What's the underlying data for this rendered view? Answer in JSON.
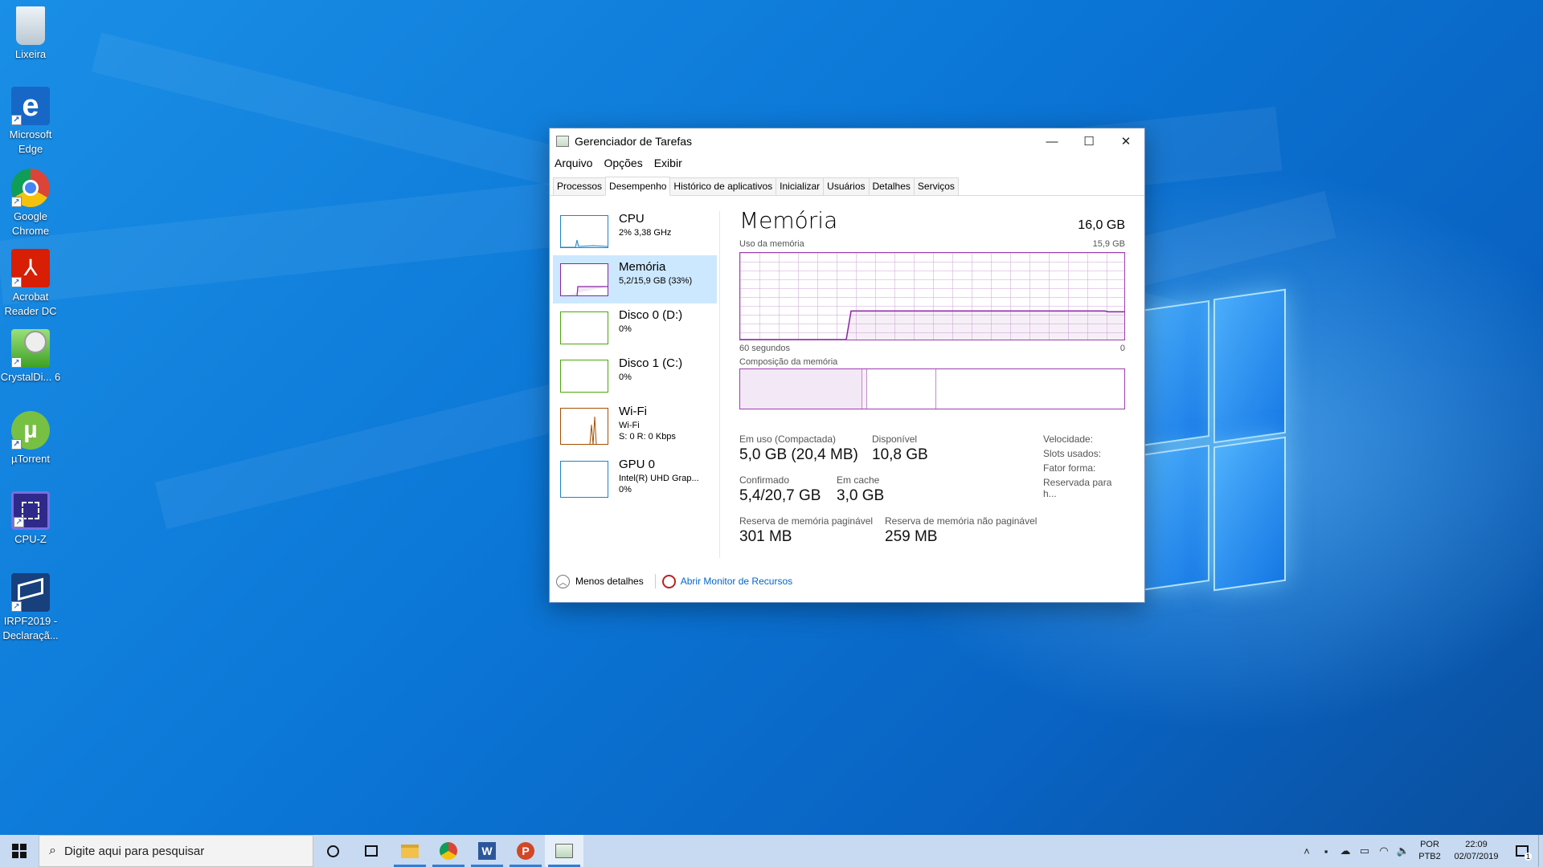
{
  "desktop": {
    "icons": [
      {
        "label": "Lixeira",
        "icon": "recycle-bin-icon"
      },
      {
        "label": "Microsoft Edge",
        "icon": "edge-icon"
      },
      {
        "label": "Google Chrome",
        "icon": "chrome-icon"
      },
      {
        "label": "Acrobat Reader DC",
        "icon": "acrobat-icon"
      },
      {
        "label": "CrystalDi... 6",
        "icon": "crystaldisk-icon"
      },
      {
        "label": "µTorrent",
        "icon": "utorrent-icon"
      },
      {
        "label": "CPU-Z",
        "icon": "cpuz-icon"
      },
      {
        "label": "IRPF2019 - Declaraçã...",
        "icon": "irpf-icon"
      }
    ]
  },
  "window": {
    "title": "Gerenciador de Tarefas",
    "controls": {
      "minimize": "—",
      "maximize": "☐",
      "close": "✕"
    },
    "menu": [
      "Arquivo",
      "Opções",
      "Exibir"
    ],
    "tabs": [
      "Processos",
      "Desempenho",
      "Histórico de aplicativos",
      "Inicializar",
      "Usuários",
      "Detalhes",
      "Serviços"
    ],
    "active_tab": "Desempenho",
    "side": [
      {
        "title": "CPU",
        "lines": [
          "2% 3,38 GHz"
        ],
        "color": "#1b86c9"
      },
      {
        "title": "Memória",
        "lines": [
          "5,2/15,9 GB (33%)"
        ],
        "color": "#8b24a3"
      },
      {
        "title": "Disco 0 (D:)",
        "lines": [
          "0%"
        ],
        "color": "#4da60c"
      },
      {
        "title": "Disco 1 (C:)",
        "lines": [
          "0%"
        ],
        "color": "#4da60c"
      },
      {
        "title": "Wi-Fi",
        "lines": [
          "Wi-Fi",
          "S: 0 R: 0 Kbps"
        ],
        "color": "#a74f01"
      },
      {
        "title": "GPU 0",
        "lines": [
          "Intel(R) UHD Grap...",
          "0%"
        ],
        "color": "#1b86c9"
      }
    ],
    "main": {
      "title": "Memória",
      "total": "16,0 GB",
      "usage_label": "Uso da memória",
      "usage_max": "15,9 GB",
      "axis_left": "60 segundos",
      "axis_right": "0",
      "composition_label": "Composição da memória",
      "usage_fraction": 0.33,
      "stats": {
        "in_use_label": "Em uso (Compactada)",
        "in_use_value": "5,0 GB (20,4 MB)",
        "available_label": "Disponível",
        "available_value": "10,8 GB",
        "committed_label": "Confirmado",
        "committed_value": "5,4/20,7 GB",
        "cached_label": "Em cache",
        "cached_value": "3,0 GB",
        "paged_label": "Reserva de memória paginável",
        "paged_value": "301 MB",
        "nonpaged_label": "Reserva de memória não paginável",
        "nonpaged_value": "259 MB"
      },
      "right_labels": [
        "Velocidade:",
        "Slots usados:",
        "Fator forma:",
        "Reservada para h..."
      ]
    },
    "footer": {
      "less_details": "Menos detalhes",
      "resource_monitor": "Abrir Monitor de Recursos"
    }
  },
  "taskbar": {
    "search_placeholder": "Digite aqui para pesquisar",
    "apps": [
      "cortana-icon",
      "task-view-icon",
      "file-explorer-icon",
      "chrome-icon",
      "word-icon",
      "powerpoint-icon",
      "task-manager-icon"
    ],
    "lang_top": "POR",
    "lang_bottom": "PTB2",
    "time": "22:09",
    "date": "02/07/2019",
    "notification_count": "1"
  },
  "colors": {
    "memory_accent": "#9c3fb0",
    "selected_item": "#cce8ff",
    "link": "#0066cc"
  }
}
